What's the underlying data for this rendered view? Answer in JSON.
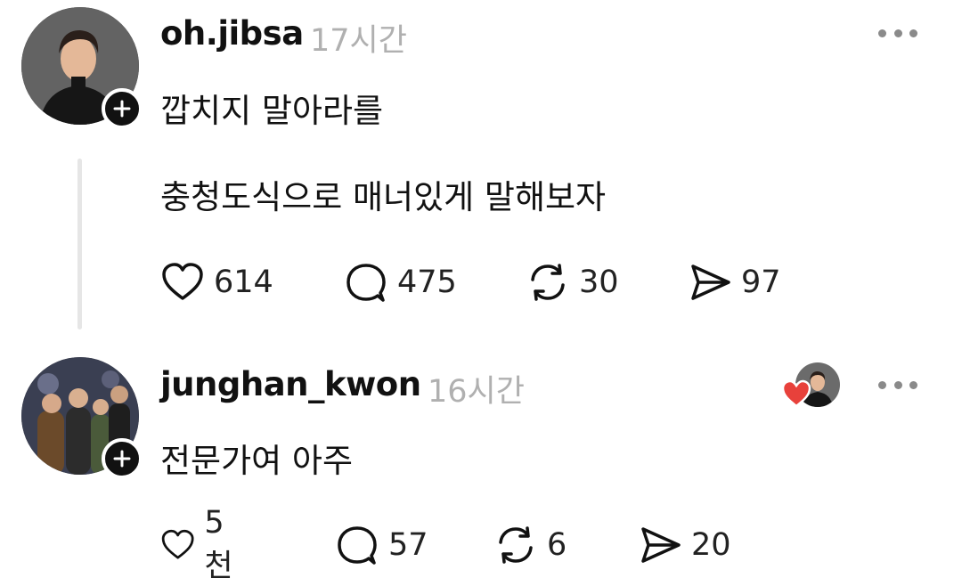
{
  "posts": [
    {
      "username": "oh.jibsa",
      "time": "17시간",
      "lines": [
        "깝치지 말아라를",
        "충청도식으로 매너있게 말해보자"
      ],
      "actions": {
        "likes": "614",
        "replies": "475",
        "reposts": "30",
        "shares": "97"
      },
      "avatar_icon": "profile-avatar-man-black-turtleneck"
    },
    {
      "username": "junghan_kwon",
      "time": "16시간",
      "lines": [
        "전문가여 아주"
      ],
      "actions": {
        "likes": "5천",
        "replies": "57",
        "reposts": "6",
        "shares": "20"
      },
      "avatar_icon": "profile-avatar-family-painting",
      "liked_by_author_icon": "author-liked-heart-avatar"
    }
  ],
  "colors": {
    "text": "#111111",
    "time": "#b0b0b0",
    "liked_heart": "#e8413b",
    "thread_line": "#e6e6e6"
  }
}
